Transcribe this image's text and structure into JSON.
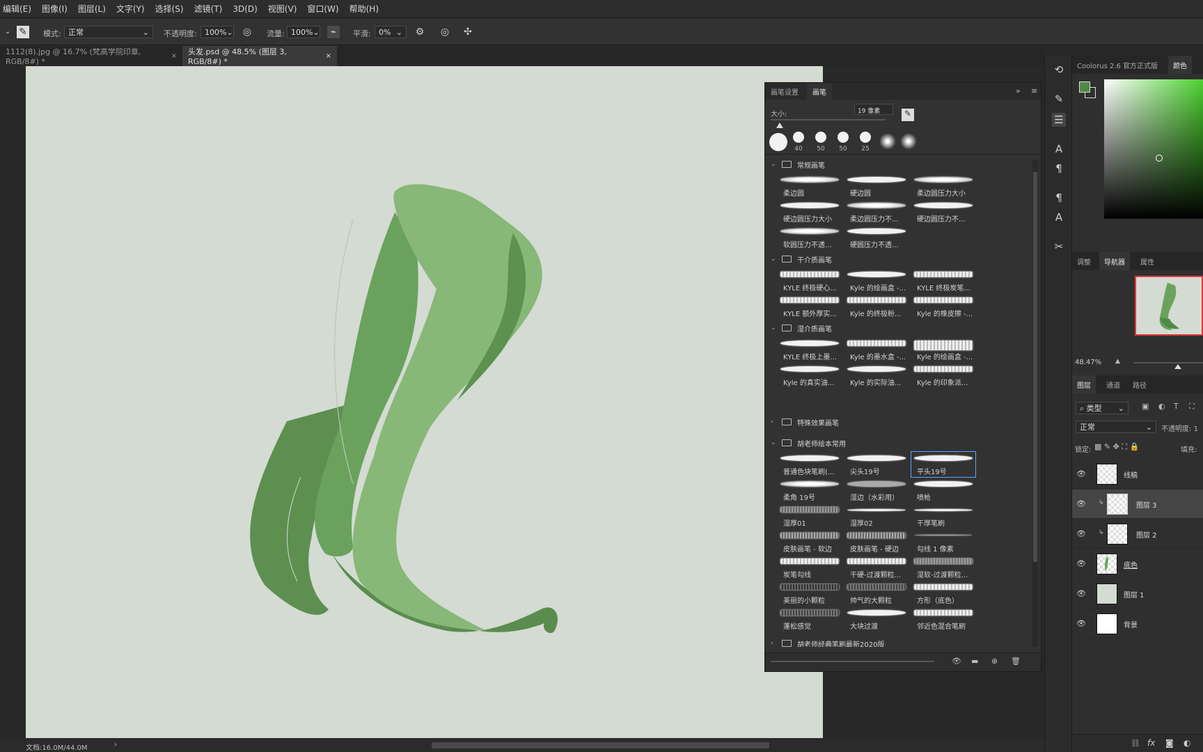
{
  "menu": [
    "编辑(E)",
    "图像(I)",
    "图层(L)",
    "文字(Y)",
    "选择(S)",
    "滤镜(T)",
    "3D(D)",
    "视图(V)",
    "窗口(W)",
    "帮助(H)"
  ],
  "options": {
    "mode_label": "模式:",
    "mode_value": "正常",
    "opacity_label": "不透明度:",
    "opacity_value": "100%",
    "flow_label": "流量:",
    "flow_value": "100%",
    "smooth_label": "平滑:",
    "smooth_value": "0%"
  },
  "tabs": [
    {
      "label": "1112(8).jpg @ 16.7% (梵高学院印章, RGB/8#) *",
      "close": "×"
    },
    {
      "label": "头发.psd @ 48.5% (图层 3, RGB/8#) *",
      "close": "×"
    }
  ],
  "status": {
    "doc_size": "文档:16.0M/44.0M"
  },
  "brush_panel": {
    "tabs": [
      "画笔设置",
      "画笔"
    ],
    "size_label": "大小:",
    "size_value": "19 像素",
    "tip_sizes": [
      "40",
      "50",
      "50",
      "25"
    ],
    "groups": [
      {
        "name": "常规画笔",
        "brushes": [
          "柔边圆",
          "硬边圆",
          "柔边圆压力大小",
          "硬边圆压力大小",
          "柔边圆压力不...",
          "硬边圆压力不...",
          "软圆压力不透...",
          "硬圆压力不透..."
        ]
      },
      {
        "name": "干介质画笔",
        "brushes": [
          "KYLE 终极硬心...",
          "Kyle 的绘画盒 -...",
          "KYLE 终极炭笔...",
          "KYLE 额外厚实...",
          "Kyle 的终极粉...",
          "Kyle 的橡皮擦 -..."
        ]
      },
      {
        "name": "湿介质画笔",
        "brushes": [
          "KYLE 终极上墨...",
          "Kyle 的墨水盒 -...",
          "Kyle 的绘画盒 -...",
          "Kyle 的真实油...",
          "Kyle 的实际油...",
          "Kyle 的印象派..."
        ]
      },
      {
        "name": "特殊效果画笔",
        "brushes": []
      },
      {
        "name": "胡老师绘本常用",
        "brushes": [
          "普通色块笔刷(...",
          "尖头19号",
          "平头19号",
          "柔角 19号",
          "湿边（水彩用）",
          "喷枪",
          "湿厚01",
          "湿厚02",
          "干厚笔刷",
          "皮肤画笔 - 软边",
          "皮肤画笔 - 硬边",
          "勾线 1 像素",
          "炭笔勾线",
          "干硬-过渡颗粒...",
          "湿软-过渡颗粒...",
          "美丽的小颗粒",
          "帅气的大颗粒",
          "方形（底色）",
          "蓬松感觉",
          "大块过渡",
          "邻近色混合笔刷"
        ]
      },
      {
        "name": "胡老师经典笔刷最新2020版",
        "brushes": []
      }
    ]
  },
  "color_panel": {
    "tabs": [
      "Coolorus 2.6 官方正式版",
      "颜色"
    ],
    "fg": "#4f8a45",
    "bg": "#ffffff"
  },
  "navigator": {
    "tabs": [
      "调整",
      "导航器",
      "属性"
    ],
    "zoom": "48.47%"
  },
  "layers_panel": {
    "tabs": [
      "图层",
      "通道",
      "路径"
    ],
    "filter_label": "类型",
    "blend_mode": "正常",
    "opacity_label": "不透明度:",
    "opacity_value": "1",
    "lock_label": "锁定:",
    "fill_label": "填充:",
    "layers": [
      "线稿",
      "图层 3",
      "图层 2",
      "底色",
      "图层 1",
      "背景"
    ]
  },
  "icons": [
    "brush-tool-icon",
    "gear-icon",
    "pressure-icon",
    "airbrush-icon",
    "symmetry-icon",
    "eye-icon",
    "folder-icon",
    "trash-icon",
    "new-icon",
    "fx-icon"
  ]
}
